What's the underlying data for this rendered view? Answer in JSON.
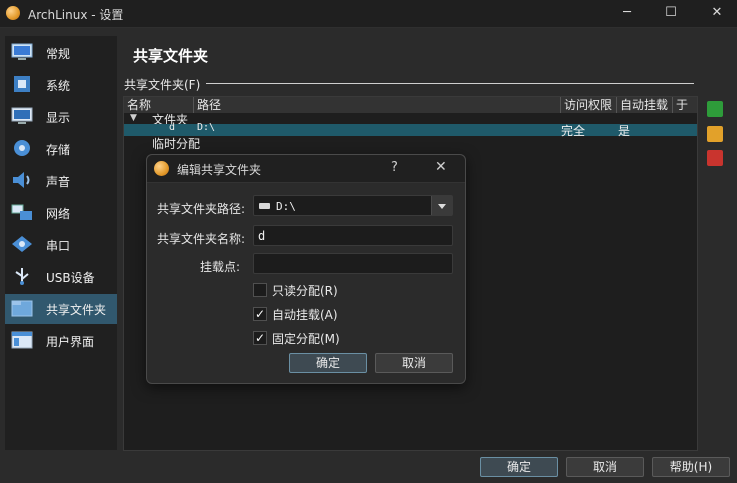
{
  "window": {
    "title": "ArchLinux - 设置"
  },
  "sidebar": {
    "items": [
      {
        "label": "常规"
      },
      {
        "label": "系统"
      },
      {
        "label": "显示"
      },
      {
        "label": "存储"
      },
      {
        "label": "声音"
      },
      {
        "label": "网络"
      },
      {
        "label": "串口"
      },
      {
        "label": "USB设备"
      },
      {
        "label": "共享文件夹"
      },
      {
        "label": "用户界面"
      }
    ],
    "selected_index": 8,
    "selected_color": "#31586e"
  },
  "page": {
    "title": "共享文件夹"
  },
  "shared_folders": {
    "group_label": "共享文件夹(F)",
    "columns": [
      "名称",
      "路径",
      "访问权限",
      "自动挂载",
      "于"
    ],
    "tree": {
      "node1": {
        "label": "文件夹"
      },
      "row": {
        "name": "d",
        "path": "D:\\",
        "access": "完全",
        "auto_mount": "是"
      },
      "node2": {
        "label": "临时分配"
      }
    }
  },
  "toolbar": {
    "icons": [
      {
        "name": "add-shared-folder-icon",
        "color": "#2e9c3a"
      },
      {
        "name": "edit-shared-folder-icon",
        "color": "#e2a12a"
      },
      {
        "name": "remove-shared-folder-icon",
        "color": "#c9342e"
      }
    ]
  },
  "dialog": {
    "title": "编辑共享文件夹",
    "help": "?",
    "path_label": "共享文件夹路径:",
    "path_value": "D:\\",
    "name_label": "共享文件夹名称:",
    "name_value": "d",
    "mount_label": "挂载点:",
    "mount_value": "",
    "readonly": {
      "label": "只读分配(R)",
      "checked": false
    },
    "automount": {
      "label": "自动挂载(A)",
      "checked": true
    },
    "permanent": {
      "label": "固定分配(M)",
      "checked": true
    },
    "ok_label": "确定",
    "cancel_label": "取消"
  },
  "footer": {
    "ok_label": "确定",
    "cancel_label": "取消",
    "help_label": "帮助(H)"
  }
}
